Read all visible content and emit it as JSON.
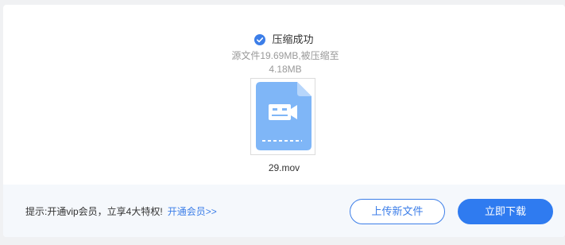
{
  "status": {
    "title": "压缩成功",
    "summary_line1": "源文件19.69MB,被压缩至",
    "summary_line2": "4.18MB"
  },
  "file": {
    "name": "29.mov",
    "icon": "video-file-icon"
  },
  "footer": {
    "tip": "提示:开通vip会员，立享4大特权!",
    "tip_link": "开通会员>>",
    "upload_button": "上传新文件",
    "download_button": "立即下载"
  },
  "colors": {
    "accent": "#2f7bf0",
    "file_icon": "#7fb6f7",
    "success_check": "#3c7ee8"
  }
}
